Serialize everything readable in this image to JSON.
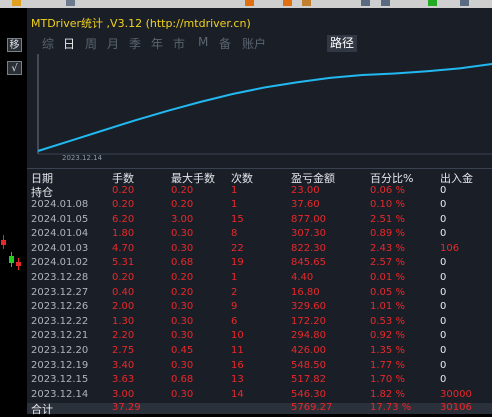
{
  "window": {
    "title": "MTDriver统计 ,V3.12 (http://mtdriver.cn)"
  },
  "gutter": {
    "btn1": "移",
    "btn2": "√"
  },
  "tabs": [
    {
      "label": "综"
    },
    {
      "label": "日",
      "active": true
    },
    {
      "label": "周"
    },
    {
      "label": "月"
    },
    {
      "label": "季"
    },
    {
      "label": "年"
    },
    {
      "label": "市"
    },
    {
      "label": "M"
    },
    {
      "label": "备"
    },
    {
      "label": "账户"
    }
  ],
  "path_tab": "路径",
  "chart_data": {
    "type": "line",
    "x_start_label": "2023.12.14",
    "curve_color": "#22b8f0",
    "values": [
      0,
      1.4,
      2.8,
      4.2,
      5.5,
      6.7,
      7.8,
      8.7,
      9.4,
      10.0,
      10.4,
      10.6,
      10.9,
      11.3,
      11.9
    ]
  },
  "table": {
    "headers": [
      "日期",
      "手数",
      "最大手数",
      "次数",
      "盈亏金额",
      "百分比%",
      "出入金"
    ],
    "holding": {
      "label": "持仓",
      "lots": "0.20",
      "max_lots": "0.20",
      "count": "1",
      "pl": "23.00",
      "pct": "0.06 %",
      "flow": "0"
    },
    "rows": [
      {
        "date": "2024.01.08",
        "lots": "0.20",
        "max_lots": "0.20",
        "count": "1",
        "pl": "37.60",
        "pct": "0.10 %",
        "flow": "0"
      },
      {
        "date": "2024.01.05",
        "lots": "6.20",
        "max_lots": "3.00",
        "count": "15",
        "pl": "877.00",
        "pct": "2.51 %",
        "flow": "0"
      },
      {
        "date": "2024.01.04",
        "lots": "1.80",
        "max_lots": "0.30",
        "count": "8",
        "pl": "307.30",
        "pct": "0.89 %",
        "flow": "0"
      },
      {
        "date": "2024.01.03",
        "lots": "4.70",
        "max_lots": "0.30",
        "count": "22",
        "pl": "822.30",
        "pct": "2.43 %",
        "flow": "106"
      },
      {
        "date": "2024.01.02",
        "lots": "5.31",
        "max_lots": "0.68",
        "count": "19",
        "pl": "845.65",
        "pct": "2.57 %",
        "flow": "0"
      },
      {
        "date": "2023.12.28",
        "lots": "0.20",
        "max_lots": "0.20",
        "count": "1",
        "pl": "4.40",
        "pct": "0.01 %",
        "flow": "0"
      },
      {
        "date": "2023.12.27",
        "lots": "0.40",
        "max_lots": "0.20",
        "count": "2",
        "pl": "16.80",
        "pct": "0.05 %",
        "flow": "0"
      },
      {
        "date": "2023.12.26",
        "lots": "2.00",
        "max_lots": "0.30",
        "count": "9",
        "pl": "329.60",
        "pct": "1.01 %",
        "flow": "0"
      },
      {
        "date": "2023.12.22",
        "lots": "1.30",
        "max_lots": "0.30",
        "count": "6",
        "pl": "172.20",
        "pct": "0.53 %",
        "flow": "0"
      },
      {
        "date": "2023.12.21",
        "lots": "2.20",
        "max_lots": "0.30",
        "count": "10",
        "pl": "294.80",
        "pct": "0.92 %",
        "flow": "0"
      },
      {
        "date": "2023.12.20",
        "lots": "2.75",
        "max_lots": "0.45",
        "count": "11",
        "pl": "426.00",
        "pct": "1.35 %",
        "flow": "0"
      },
      {
        "date": "2023.12.19",
        "lots": "3.40",
        "max_lots": "0.30",
        "count": "16",
        "pl": "548.50",
        "pct": "1.77 %",
        "flow": "0"
      },
      {
        "date": "2023.12.15",
        "lots": "3.63",
        "max_lots": "0.68",
        "count": "13",
        "pl": "517.82",
        "pct": "1.70 %",
        "flow": "0"
      },
      {
        "date": "2023.12.14",
        "lots": "3.00",
        "max_lots": "0.30",
        "count": "14",
        "pl": "546.30",
        "pct": "1.82 %",
        "flow": "30000"
      }
    ],
    "total": {
      "label": "合计",
      "lots": "37.29",
      "pl": "5769.27",
      "pct": "17.73 %",
      "flow": "30106"
    }
  },
  "colors": {
    "title": "#f2d21e",
    "value_red": "#e8282b",
    "curve": "#22b8f0",
    "panel_bg": "#1a1f27"
  }
}
